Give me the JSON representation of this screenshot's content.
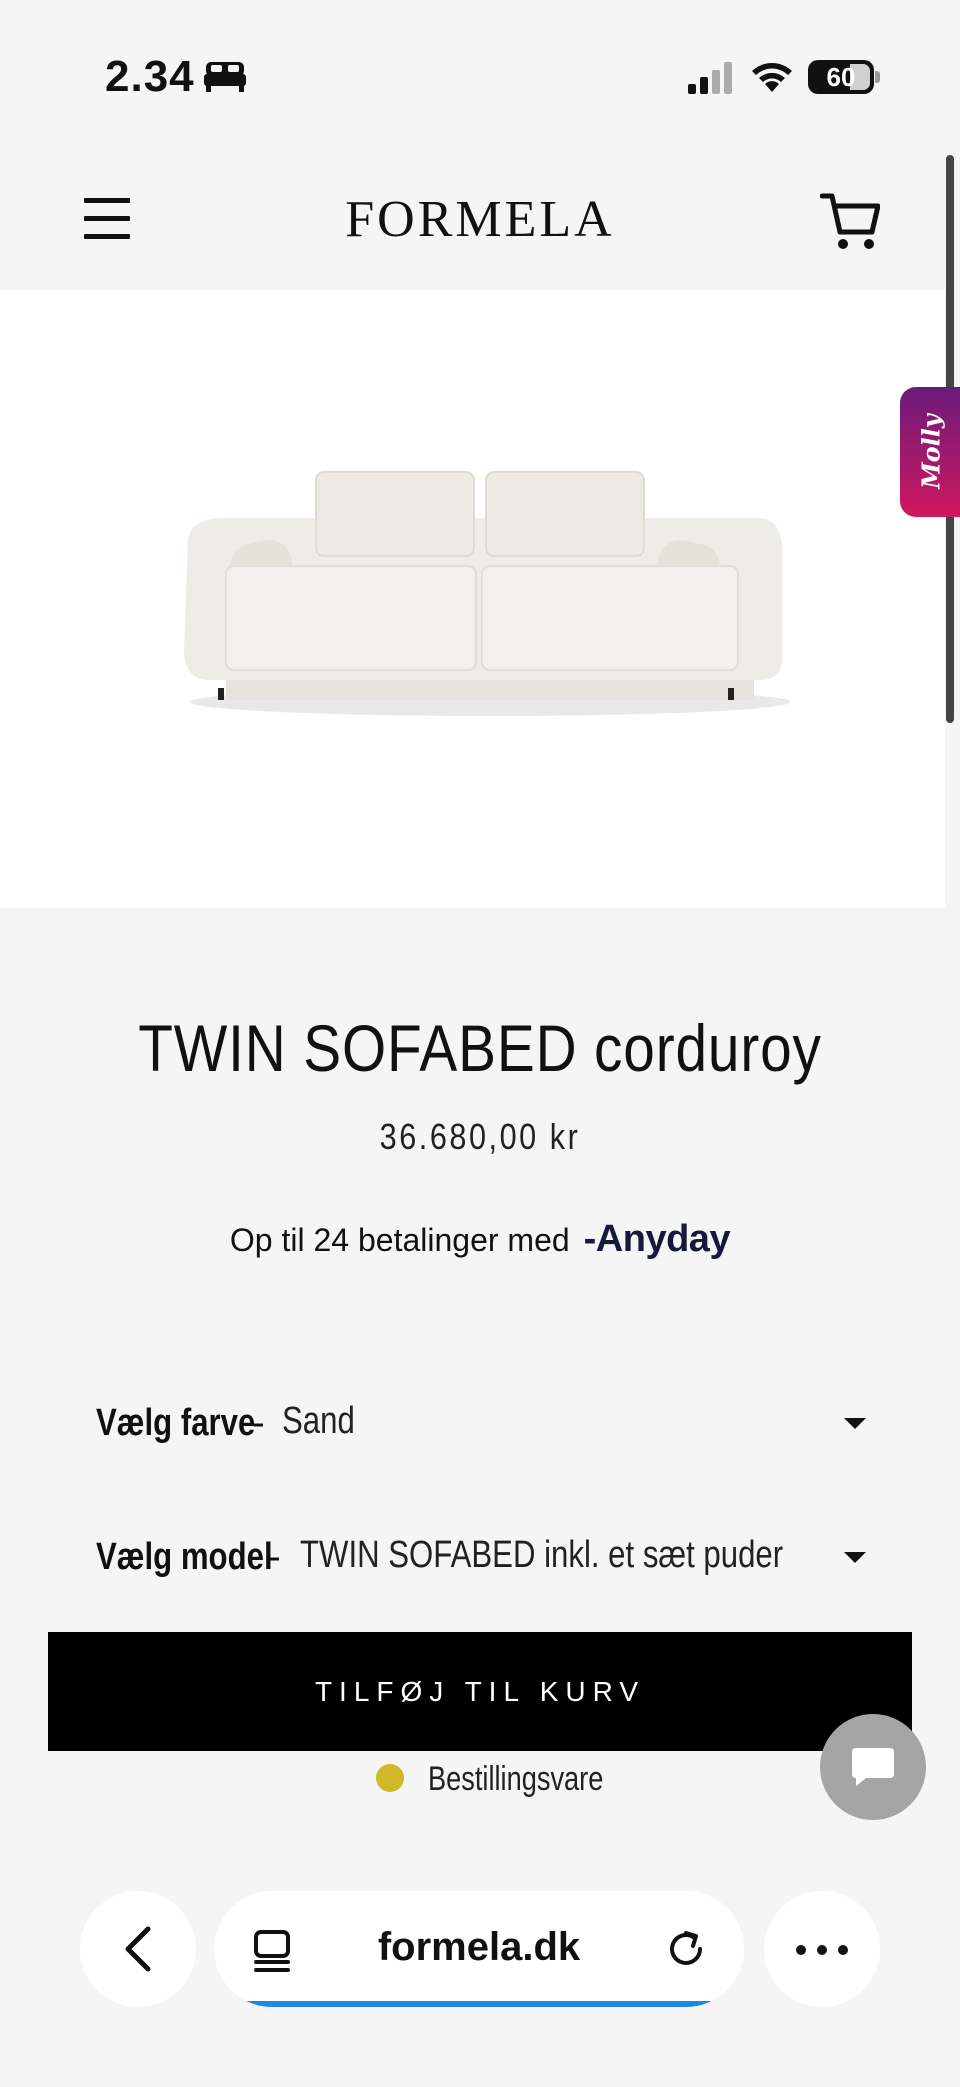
{
  "status_bar": {
    "time": "2.34",
    "battery_level": "60"
  },
  "header": {
    "logo": "FORMELA"
  },
  "molly": {
    "label": "Molly"
  },
  "product": {
    "title": "TWIN SOFABED corduroy",
    "price": "36.680,00 kr",
    "installments_text": "Op til 24 betalinger med",
    "installments_brand": "-Anyday"
  },
  "options": {
    "color": {
      "label": "Vælg farve",
      "separator": "-",
      "value": "Sand"
    },
    "model": {
      "label": "Vælg model",
      "separator": "-",
      "value": "TWIN SOFABED inkl. et sæt puder"
    }
  },
  "cart": {
    "add_label": "TILFØJ TIL KURV",
    "stock_status": "Bestillingsvare",
    "stock_color": "#d1b82a"
  },
  "browser": {
    "url": "formela.dk"
  }
}
